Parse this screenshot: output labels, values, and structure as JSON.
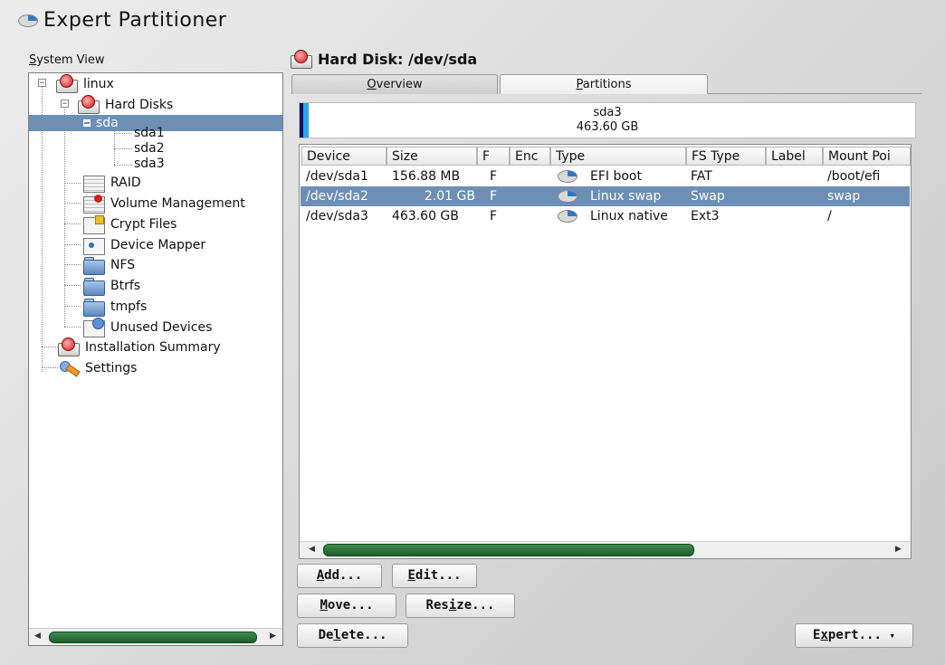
{
  "window": {
    "title": "Expert Partitioner"
  },
  "sidebar": {
    "label_underlined": "S",
    "label_rest": "ystem View",
    "tree": {
      "linux": "linux",
      "hard_disks": "Hard Disks",
      "sda": "sda",
      "sda1": "sda1",
      "sda2": "sda2",
      "sda3": "sda3",
      "raid": "RAID",
      "volume_management": "Volume Management",
      "crypt_files": "Crypt Files",
      "device_mapper": "Device Mapper",
      "nfs": "NFS",
      "btrfs": "Btrfs",
      "tmpfs": "tmpfs",
      "unused_devices": "Unused Devices",
      "installation_summary": "Installation Summary",
      "settings": "Settings"
    }
  },
  "main": {
    "disk_title": "Hard Disk: /dev/sda",
    "tabs": {
      "overview_u": "O",
      "overview_rest": "verview",
      "partitions_u": "P",
      "partitions_rest": "artitions"
    },
    "disk_bar": {
      "name": "sda3",
      "size": "463.60 GB"
    },
    "table": {
      "columns": [
        "Device",
        "Size",
        "F",
        "Enc",
        "Type",
        "FS Type",
        "Label",
        "Mount Poi"
      ],
      "rows": [
        {
          "device": "/dev/sda1",
          "size": "156.88 MB",
          "f": "F",
          "enc": "",
          "type": "EFI boot",
          "fs": "FAT",
          "label": "",
          "mount": "/boot/efi"
        },
        {
          "device": "/dev/sda2",
          "size": "2.01 GB",
          "f": "F",
          "enc": "",
          "type": "Linux swap",
          "fs": "Swap",
          "label": "",
          "mount": "swap"
        },
        {
          "device": "/dev/sda3",
          "size": "463.60 GB",
          "f": "F",
          "enc": "",
          "type": "Linux native",
          "fs": "Ext3",
          "label": "",
          "mount": "/"
        }
      ]
    },
    "buttons": {
      "add_u": "A",
      "add_rest": "dd...",
      "edit_u": "E",
      "edit_rest": "dit...",
      "move_u": "M",
      "move_rest": "ove...",
      "resize_pre": "Res",
      "resize_u": "i",
      "resize_rest": "ze...",
      "delete_pre": "De",
      "delete_u": "l",
      "delete_rest": "ete...",
      "expert_pre": "E",
      "expert_u": "x",
      "expert_rest": "pert...",
      "expert_caret": "▾"
    }
  },
  "colors": {
    "selection": "#6d8fb6",
    "scroll_thumb": "#2b7339",
    "accent_bar": "#2aa7e8"
  }
}
